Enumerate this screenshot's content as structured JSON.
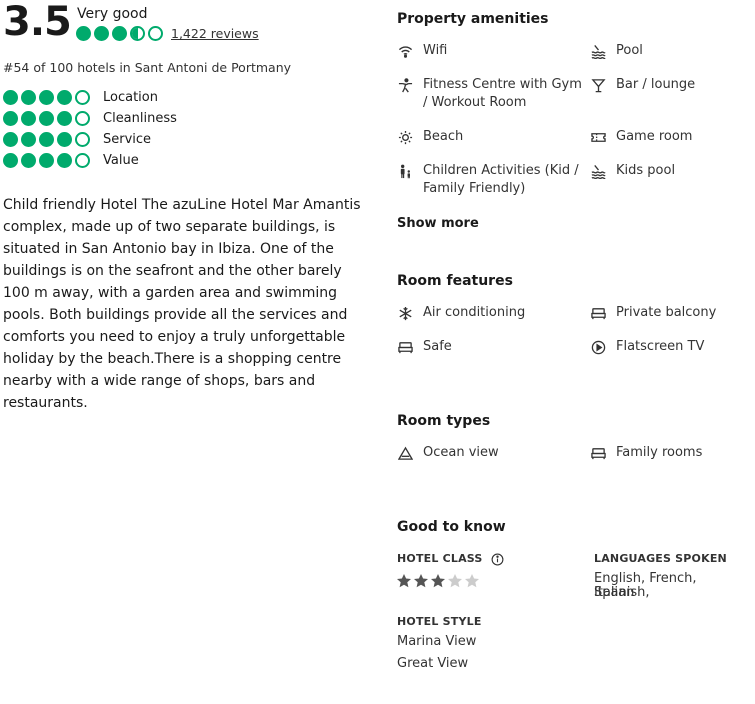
{
  "rating": {
    "score": "3.5",
    "label": "Very good",
    "bubbles_value": 3.5,
    "reviews_text": "1,422 reviews",
    "rank_text": "#54 of 100 hotels in Sant Antoni de Portmany"
  },
  "sub_ratings": [
    {
      "label": "Location",
      "value": 4
    },
    {
      "label": "Cleanliness",
      "value": 4
    },
    {
      "label": "Service",
      "value": 4
    },
    {
      "label": "Value",
      "value": 4
    }
  ],
  "description": "Child friendly Hotel The azuLine Hotel Mar Amantis complex, made up of two separate buildings, is situated in San Antonio bay in Ibiza. One of the buildings is on the seafront and the other barely 100 m away, with a garden area and swimming pools. Both buildings provide all the services and comforts you need to enjoy a truly unforgettable holiday by the beach.There is a shopping centre nearby with a wide range of shops, bars and restaurants.",
  "amenities": {
    "title": "Property amenities",
    "items": [
      {
        "label": "Wifi",
        "icon": "wifi-icon"
      },
      {
        "label": "Pool",
        "icon": "pool-icon"
      },
      {
        "label": "Fitness Centre with Gym / Workout Room",
        "icon": "fitness-icon"
      },
      {
        "label": "Bar / lounge",
        "icon": "cocktail-icon"
      },
      {
        "label": "Beach",
        "icon": "sun-icon"
      },
      {
        "label": "Game room",
        "icon": "ticket-icon"
      },
      {
        "label": "Children Activities (Kid / Family Friendly)",
        "icon": "family-icon"
      },
      {
        "label": "Kids pool",
        "icon": "pool-icon"
      }
    ],
    "show_more": "Show more"
  },
  "room_features": {
    "title": "Room features",
    "items": [
      {
        "label": "Air conditioning",
        "icon": "snowflake-icon"
      },
      {
        "label": "Private balcony",
        "icon": "bed-icon"
      },
      {
        "label": "Safe",
        "icon": "bed-icon"
      },
      {
        "label": "Flatscreen TV",
        "icon": "play-icon"
      }
    ]
  },
  "room_types": {
    "title": "Room types",
    "items": [
      {
        "label": "Ocean view",
        "icon": "mountain-icon"
      },
      {
        "label": "Family rooms",
        "icon": "bed-icon"
      }
    ]
  },
  "good_to_know": {
    "title": "Good to know",
    "hotel_class_label": "HOTEL CLASS",
    "hotel_class_stars": 3,
    "languages_label": "LANGUAGES SPOKEN",
    "languages_line1": "English, French, Spanish,",
    "languages_line2": "Italian",
    "hotel_style_label": "HOTEL STYLE",
    "styles": [
      "Marina View",
      "Great View"
    ]
  },
  "colors": {
    "bubble_green": "#00aa6c",
    "star_dark": "#555555",
    "star_light": "#cccccc"
  }
}
